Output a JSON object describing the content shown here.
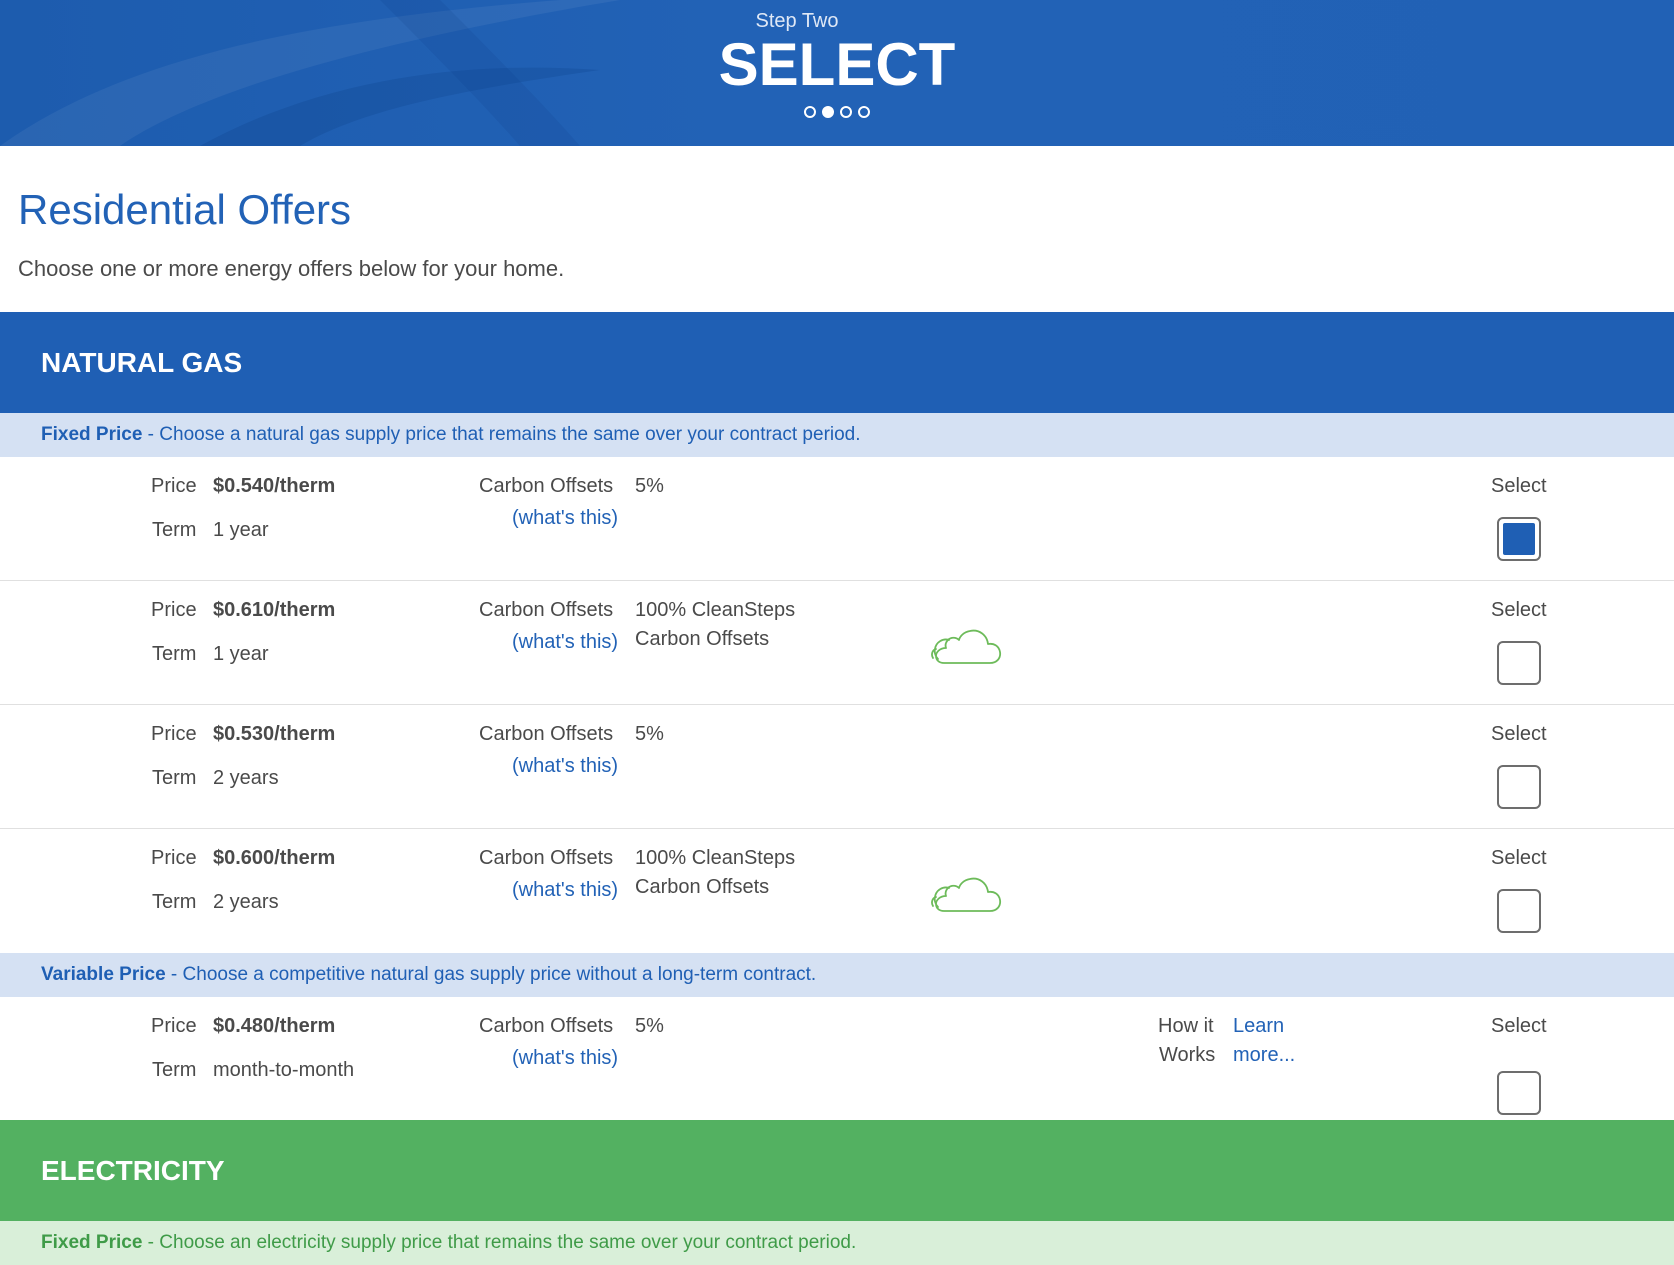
{
  "header": {
    "step_label": "Step Two",
    "step_title": "SELECT",
    "progress": {
      "total_steps": 4,
      "current_step": 2
    }
  },
  "intro": {
    "title": "Residential Offers",
    "subtitle": "Choose one or more energy offers below for your home."
  },
  "colors": {
    "gas_blue": "#1f5fb4",
    "electric_green": "#53b161",
    "link_blue": "#2262b6"
  },
  "natural_gas": {
    "heading": "NATURAL GAS",
    "fixed": {
      "label": "Fixed Price",
      "description": " - Choose a natural gas supply price that remains the same over your contract period."
    },
    "variable": {
      "label": "Variable Price",
      "description": " - Choose a competitive natural gas supply price without a long-term contract."
    },
    "labels": {
      "price": "Price",
      "term": "Term",
      "carbon_offsets": "Carbon Offsets",
      "whats_this": "(what's this)",
      "select": "Select",
      "how_it": "How it",
      "works": "Works",
      "learn": "Learn",
      "more": "more..."
    },
    "fixed_offers": [
      {
        "price": "$0.540/therm",
        "term": "1 year",
        "offset": "5%",
        "offset_line2": "",
        "clean_steps": false,
        "selected": true
      },
      {
        "price": "$0.610/therm",
        "term": "1 year",
        "offset": "100% CleanSteps",
        "offset_line2": "Carbon Offsets",
        "clean_steps": true,
        "selected": false
      },
      {
        "price": "$0.530/therm",
        "term": "2 years",
        "offset": "5%",
        "offset_line2": "",
        "clean_steps": false,
        "selected": false
      },
      {
        "price": "$0.600/therm",
        "term": "2 years",
        "offset": "100% CleanSteps",
        "offset_line2": "Carbon Offsets",
        "clean_steps": true,
        "selected": false
      }
    ],
    "variable_offer": {
      "price": "$0.480/therm",
      "term": "month-to-month",
      "offset": "5%",
      "selected": false
    }
  },
  "electricity": {
    "heading": "ELECTRICITY",
    "fixed": {
      "label": "Fixed Price",
      "description": " - Choose an electricity supply price that remains the same over your contract period."
    }
  }
}
